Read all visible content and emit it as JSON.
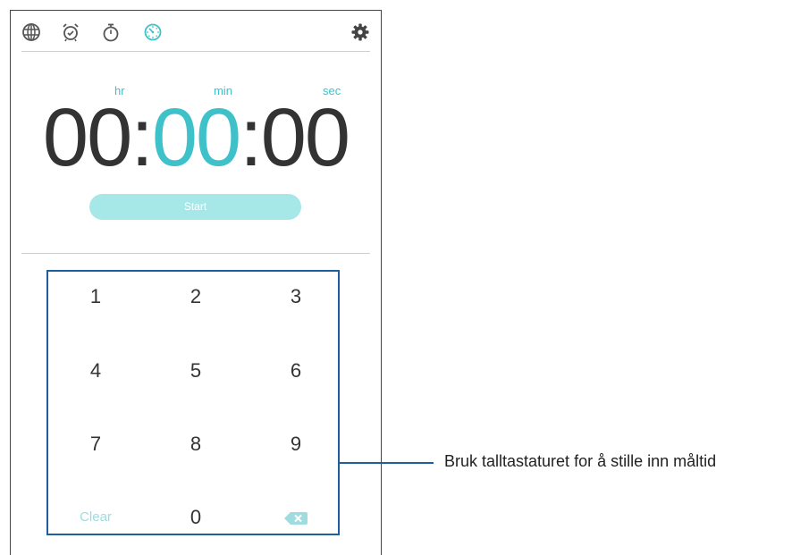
{
  "toolbar": {
    "icons": [
      {
        "name": "globe-icon",
        "label": "world clock"
      },
      {
        "name": "alarm-icon",
        "label": "alarm"
      },
      {
        "name": "stopwatch-icon",
        "label": "stopwatch"
      },
      {
        "name": "timer-icon",
        "label": "timer",
        "active": true
      }
    ],
    "settings_icon": "gear-icon"
  },
  "timer": {
    "unit_hr": "hr",
    "unit_min": "min",
    "unit_sec": "sec",
    "hours": "00",
    "minutes": "00",
    "seconds": "00",
    "separator": ":"
  },
  "start_label": "Start",
  "keypad": {
    "keys": [
      "1",
      "2",
      "3",
      "4",
      "5",
      "6",
      "7",
      "8",
      "9"
    ],
    "clear_label": "Clear",
    "zero": "0",
    "backspace_icon": "backspace-icon"
  },
  "callout": "Bruk talltastaturet for å stille inn måltid",
  "colors": {
    "accent": "#3fc1c9",
    "start_button": "#a6e8e8",
    "callout_border": "#1f5f9e",
    "text_dark": "#333333"
  }
}
